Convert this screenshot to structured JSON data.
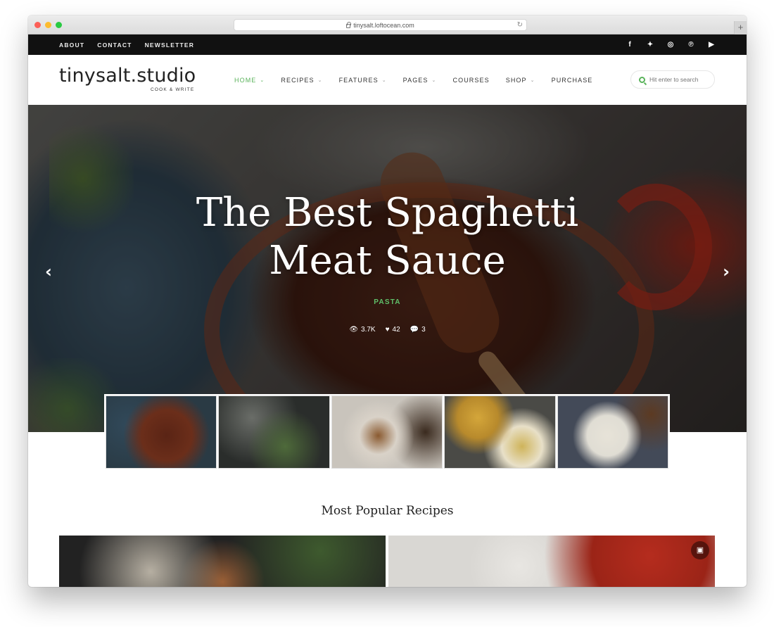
{
  "browser": {
    "url": "tinysalt.loftocean.com"
  },
  "topbar": {
    "links": [
      "ABOUT",
      "CONTACT",
      "NEWSLETTER"
    ],
    "social": [
      "facebook-icon",
      "twitter-icon",
      "instagram-icon",
      "pinterest-icon",
      "youtube-icon"
    ]
  },
  "logo": {
    "main": "tinysalt.studio",
    "sub": "COOK & WRITE"
  },
  "nav": {
    "items": [
      {
        "label": "HOME",
        "active": true,
        "dropdown": true
      },
      {
        "label": "RECIPES",
        "dropdown": true
      },
      {
        "label": "FEATURES",
        "dropdown": true
      },
      {
        "label": "PAGES",
        "dropdown": true
      },
      {
        "label": "COURSES",
        "dropdown": false
      },
      {
        "label": "SHOP",
        "dropdown": true
      },
      {
        "label": "PURCHASE",
        "dropdown": false
      }
    ]
  },
  "search": {
    "placeholder": "Hit enter to search"
  },
  "hero": {
    "title": "The Best Spaghetti Meat Sauce",
    "category": "PASTA",
    "views": "3.7K",
    "likes": "42",
    "comments": "3"
  },
  "thumbnails": [
    "spaghetti-meat-sauce",
    "jars-and-herbs",
    "roasted-potatoes",
    "soup-bowls",
    "egg-salad-plate"
  ],
  "section": {
    "title": "Most Popular Recipes"
  },
  "colors": {
    "accent": "#59b35a",
    "topbar": "#111111"
  }
}
